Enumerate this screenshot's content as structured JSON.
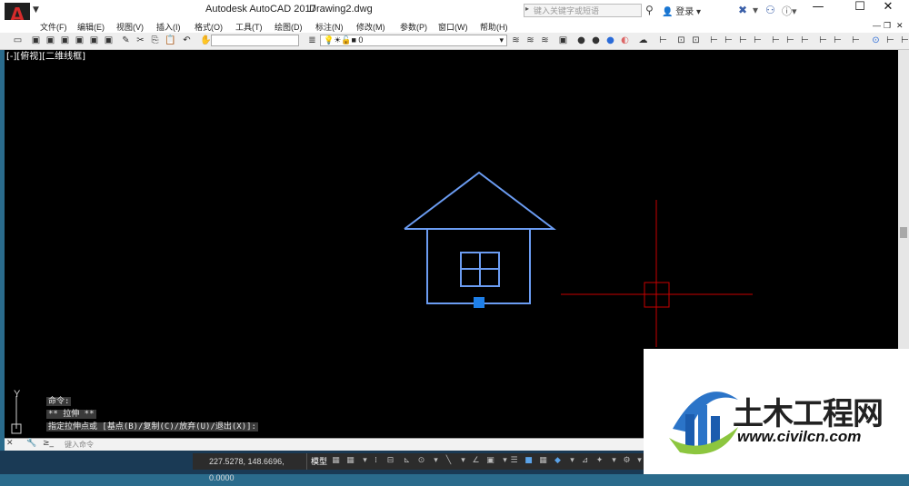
{
  "title_bar": {
    "app_title": "Autodesk AutoCAD 2017",
    "doc_title": "Drawing2.dwg",
    "search_placeholder": "键入关键字或短语",
    "login_label": "登录",
    "window_buttons": [
      "—",
      "☐",
      "✕"
    ]
  },
  "menu_bar": {
    "items": [
      "文件(F)",
      "编辑(E)",
      "视图(V)",
      "插入(I)",
      "格式(O)",
      "工具(T)",
      "绘图(D)",
      "标注(N)",
      "修改(M)",
      "参数(P)",
      "窗口(W)",
      "帮助(H)"
    ]
  },
  "toolbar": {
    "layer_value": "0"
  },
  "drawing": {
    "house_color": "#6b9cf2",
    "grip_color": "#1e7fe8",
    "cursor_color": "#c80000",
    "ucs_y_label": "Y"
  },
  "command_history": [
    "命令:",
    "** 拉伸 **",
    "指定拉伸点或 [基点(B)/复制(C)/放弃(U)/退出(X)]:"
  ],
  "command_line": {
    "placeholder": "键入命令",
    "prompt_symbol": "≥_"
  },
  "status_bar": {
    "coordinates": "227.5278, 148.6696, 0.0000",
    "model_label": "模型"
  },
  "watermark": {
    "name_cn": "土木工程网",
    "url": "www.civilcn.com"
  }
}
